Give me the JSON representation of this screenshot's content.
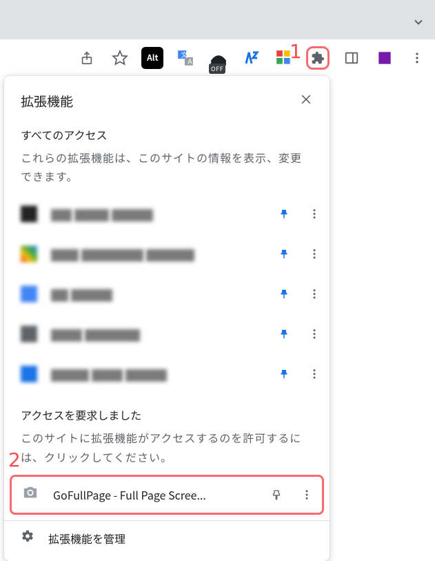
{
  "annotations": {
    "one": "1",
    "two": "2"
  },
  "toolbar": {
    "alt_label": "Alt",
    "off_label": "OFF"
  },
  "popup": {
    "title": "拡張機能",
    "section1_title": "すべてのアクセス",
    "section1_desc": "これらの拡張機能は、このサイトの情報を表示、変更できます。",
    "section2_title": "アクセスを要求しました",
    "section2_desc": "このサイトに拡張機能がアクセスするのを許可するには、クリックしてください。",
    "gofullpage_name": "GoFullPage - Full Page Scree...",
    "manage_label": "拡張機能を管理"
  }
}
